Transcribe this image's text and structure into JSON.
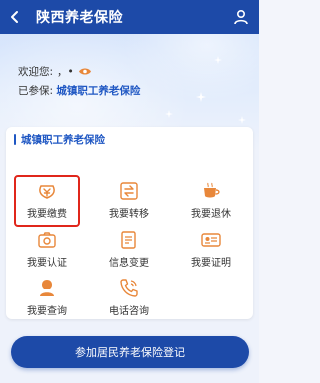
{
  "header": {
    "title": "陕西养老保险"
  },
  "hero": {
    "welcome_label": "欢迎您:",
    "welcome_name": "，•",
    "insured_label": "已参保:",
    "insured_type": "城镇职工养老保险"
  },
  "card": {
    "title": "城镇职工养老保险",
    "services": [
      {
        "label": "我要缴费",
        "icon": "payment-icon"
      },
      {
        "label": "我要转移",
        "icon": "transfer-icon"
      },
      {
        "label": "我要退休",
        "icon": "retire-icon"
      },
      {
        "label": "我要认证",
        "icon": "verify-icon"
      },
      {
        "label": "信息变更",
        "icon": "info-change-icon"
      },
      {
        "label": "我要证明",
        "icon": "certificate-icon"
      },
      {
        "label": "我要查询",
        "icon": "query-icon"
      },
      {
        "label": "电话咨询",
        "icon": "phone-icon"
      }
    ]
  },
  "footer": {
    "button_label": "参加居民养老保险登记"
  },
  "colors": {
    "primary": "#1d4aa8",
    "accent": "#1f57c3",
    "highlight": "#e0261b",
    "icon_orange": "#e8873a"
  }
}
